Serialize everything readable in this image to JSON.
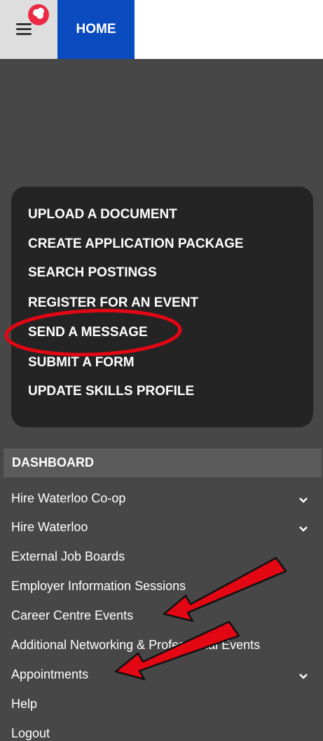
{
  "header": {
    "home_label": "HOME"
  },
  "quick_actions": [
    "UPLOAD A DOCUMENT",
    "CREATE APPLICATION PACKAGE",
    "SEARCH POSTINGS",
    "REGISTER FOR AN EVENT",
    "SEND A MESSAGE",
    "SUBMIT A FORM",
    "UPDATE SKILLS PROFILE"
  ],
  "nav": {
    "section_title": "DASHBOARD",
    "items": [
      "Hire Waterloo Co-op",
      "Hire Waterloo",
      "External Job Boards",
      "Employer Information Sessions",
      "Career Centre Events",
      "Additional Networking & Professional Events",
      "Appointments",
      "Help",
      "Logout"
    ]
  },
  "colors": {
    "home_blue": "#0a4bc0",
    "badge_red": "#ea2a43",
    "annotation_red": "#e30613"
  },
  "icons": [
    "hamburger-menu-icon",
    "notification-badge-icon",
    "chevron-down-icon"
  ]
}
